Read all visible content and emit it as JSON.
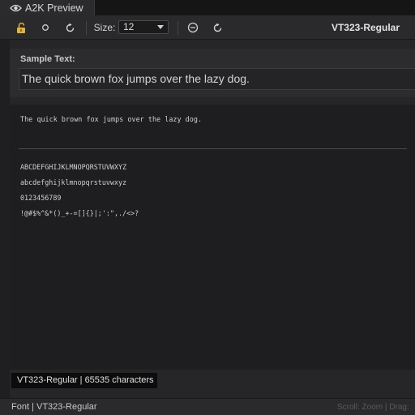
{
  "window": {
    "tab_title": "A2K Preview",
    "tab_icon": "eye-icon"
  },
  "toolbar": {
    "lock_icon": "lock-open-icon",
    "record_icon": "circle-icon",
    "refresh_icon": "refresh-icon",
    "size_label": "Size:",
    "size_value": "12",
    "zoom_out_icon": "minus-circle-icon",
    "reset_icon": "reset-icon",
    "font_name": "VT323-Regular",
    "accent_color": "#e2b33c"
  },
  "sample": {
    "label": "Sample Text:",
    "value": "The quick brown fox jumps over the lazy dog."
  },
  "preview": {
    "sample_line": "The quick brown fox jumps over the lazy dog.",
    "charset": [
      "ABCDEFGHIJKLMNOPQRSTUVWXYZ",
      "abcdefghijklmnopqrstuvwxyz",
      "0123456789",
      "!@#$%^&*()_+-=[]{}|;':\",./<>?"
    ]
  },
  "overlay": {
    "info": "VT323-Regular | 65535 characters"
  },
  "statusbar": {
    "left": "Font | VT323-Regular",
    "right": "Scroll: Zoom | Drag:"
  }
}
